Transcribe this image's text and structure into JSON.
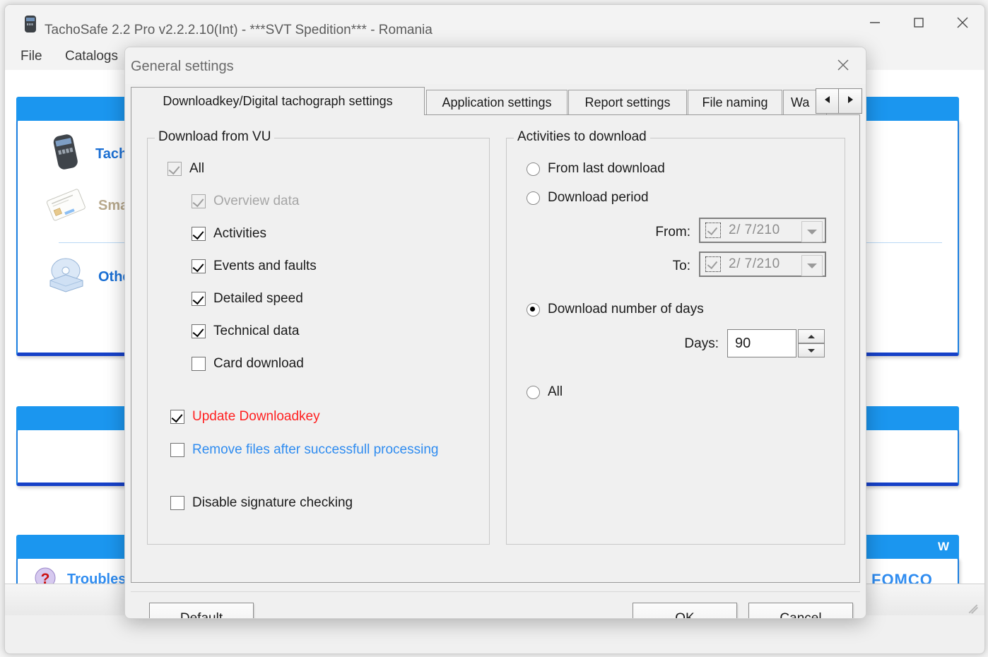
{
  "window": {
    "title": "TachoSafe 2.2 Pro v2.2.2.10(Int) - ***SVT Spedition*** - Romania",
    "icon": "downloadkey-icon",
    "controls": {
      "minimize": "–",
      "maximize": "☐",
      "close": "✕"
    }
  },
  "menubar": {
    "items": [
      {
        "label": "File"
      },
      {
        "label": "Catalogs"
      }
    ]
  },
  "background_panels": [
    {
      "header": "",
      "items": [
        {
          "label": "TachoSafe Downloadkeys",
          "icon": "downloadkey-icon",
          "color": "#1a6fd4",
          "enabled": true
        },
        {
          "label": "Smart card reader",
          "icon": "smartcard-icon",
          "color": "#b8a98d",
          "enabled": false
        },
        {
          "label": "Other device / Digital tachograph",
          "icon": "disc-drive-icon",
          "color": "#1a6fd4",
          "enabled": true
        }
      ]
    },
    {
      "header": "",
      "items": []
    },
    {
      "header": "W",
      "items": [
        {
          "label": "Troubleshooting",
          "icon": "help-question-icon",
          "color": "#2f8cf0",
          "enabled": true
        },
        {
          "label": "FOMCO",
          "icon": "fomco-logo-icon",
          "color": "#2f8cf0",
          "enabled": true
        }
      ]
    }
  ],
  "dialog": {
    "title": "General settings",
    "close_label": "✕",
    "tabs": [
      {
        "label": "Downloadkey/Digital tachograph settings",
        "active": true
      },
      {
        "label": "Application settings",
        "active": false
      },
      {
        "label": "Report settings",
        "active": false
      },
      {
        "label": "File naming",
        "active": false
      },
      {
        "label": "Wa",
        "active": false
      }
    ],
    "tab_scroll": {
      "left": "◀",
      "right": "▶"
    },
    "download_from_vu": {
      "title": "Download from VU",
      "checkboxes": [
        {
          "label": "All",
          "checked": true,
          "enabled": false,
          "indent": 0,
          "color": "#1b1b1b"
        },
        {
          "label": "Overview data",
          "checked": true,
          "enabled": false,
          "indent": 1,
          "color": "#a6a6a6"
        },
        {
          "label": "Activities",
          "checked": true,
          "enabled": true,
          "indent": 1,
          "color": "#1b1b1b"
        },
        {
          "label": "Events and faults",
          "checked": true,
          "enabled": true,
          "indent": 1,
          "color": "#1b1b1b"
        },
        {
          "label": "Detailed speed",
          "checked": true,
          "enabled": true,
          "indent": 1,
          "color": "#1b1b1b"
        },
        {
          "label": "Technical data",
          "checked": true,
          "enabled": true,
          "indent": 1,
          "color": "#1b1b1b"
        },
        {
          "label": "Card download",
          "checked": false,
          "enabled": true,
          "indent": 1,
          "color": "#1b1b1b"
        }
      ],
      "extra_checkboxes": [
        {
          "label": "Update Downloadkey",
          "checked": true,
          "enabled": true,
          "color": "#ff2020"
        },
        {
          "label": "Remove files after successfull processing",
          "checked": false,
          "enabled": true,
          "color": "#2f8cf0"
        },
        {
          "label": "Disable signature checking",
          "checked": false,
          "enabled": true,
          "color": "#1b1b1b"
        }
      ]
    },
    "activities_to_download": {
      "title": "Activities to download",
      "options": [
        {
          "label": "From last download",
          "selected": false
        },
        {
          "label": "Download period",
          "selected": false
        },
        {
          "label": "Download number of days",
          "selected": true
        },
        {
          "label": "All",
          "selected": false
        }
      ],
      "from_label": "From:",
      "from_value": "2/  7/210",
      "to_label": "To:",
      "to_value": "2/  7/210",
      "days_label": "Days:",
      "days_value": "90"
    },
    "buttons": {
      "default": "Default",
      "ok": "OK",
      "cancel": "Cancel"
    }
  },
  "colors": {
    "accent_blue": "#1b96ef",
    "panel_border": "#1a7fe0",
    "red_text": "#ff2020",
    "blue_text": "#2f8cf0"
  }
}
